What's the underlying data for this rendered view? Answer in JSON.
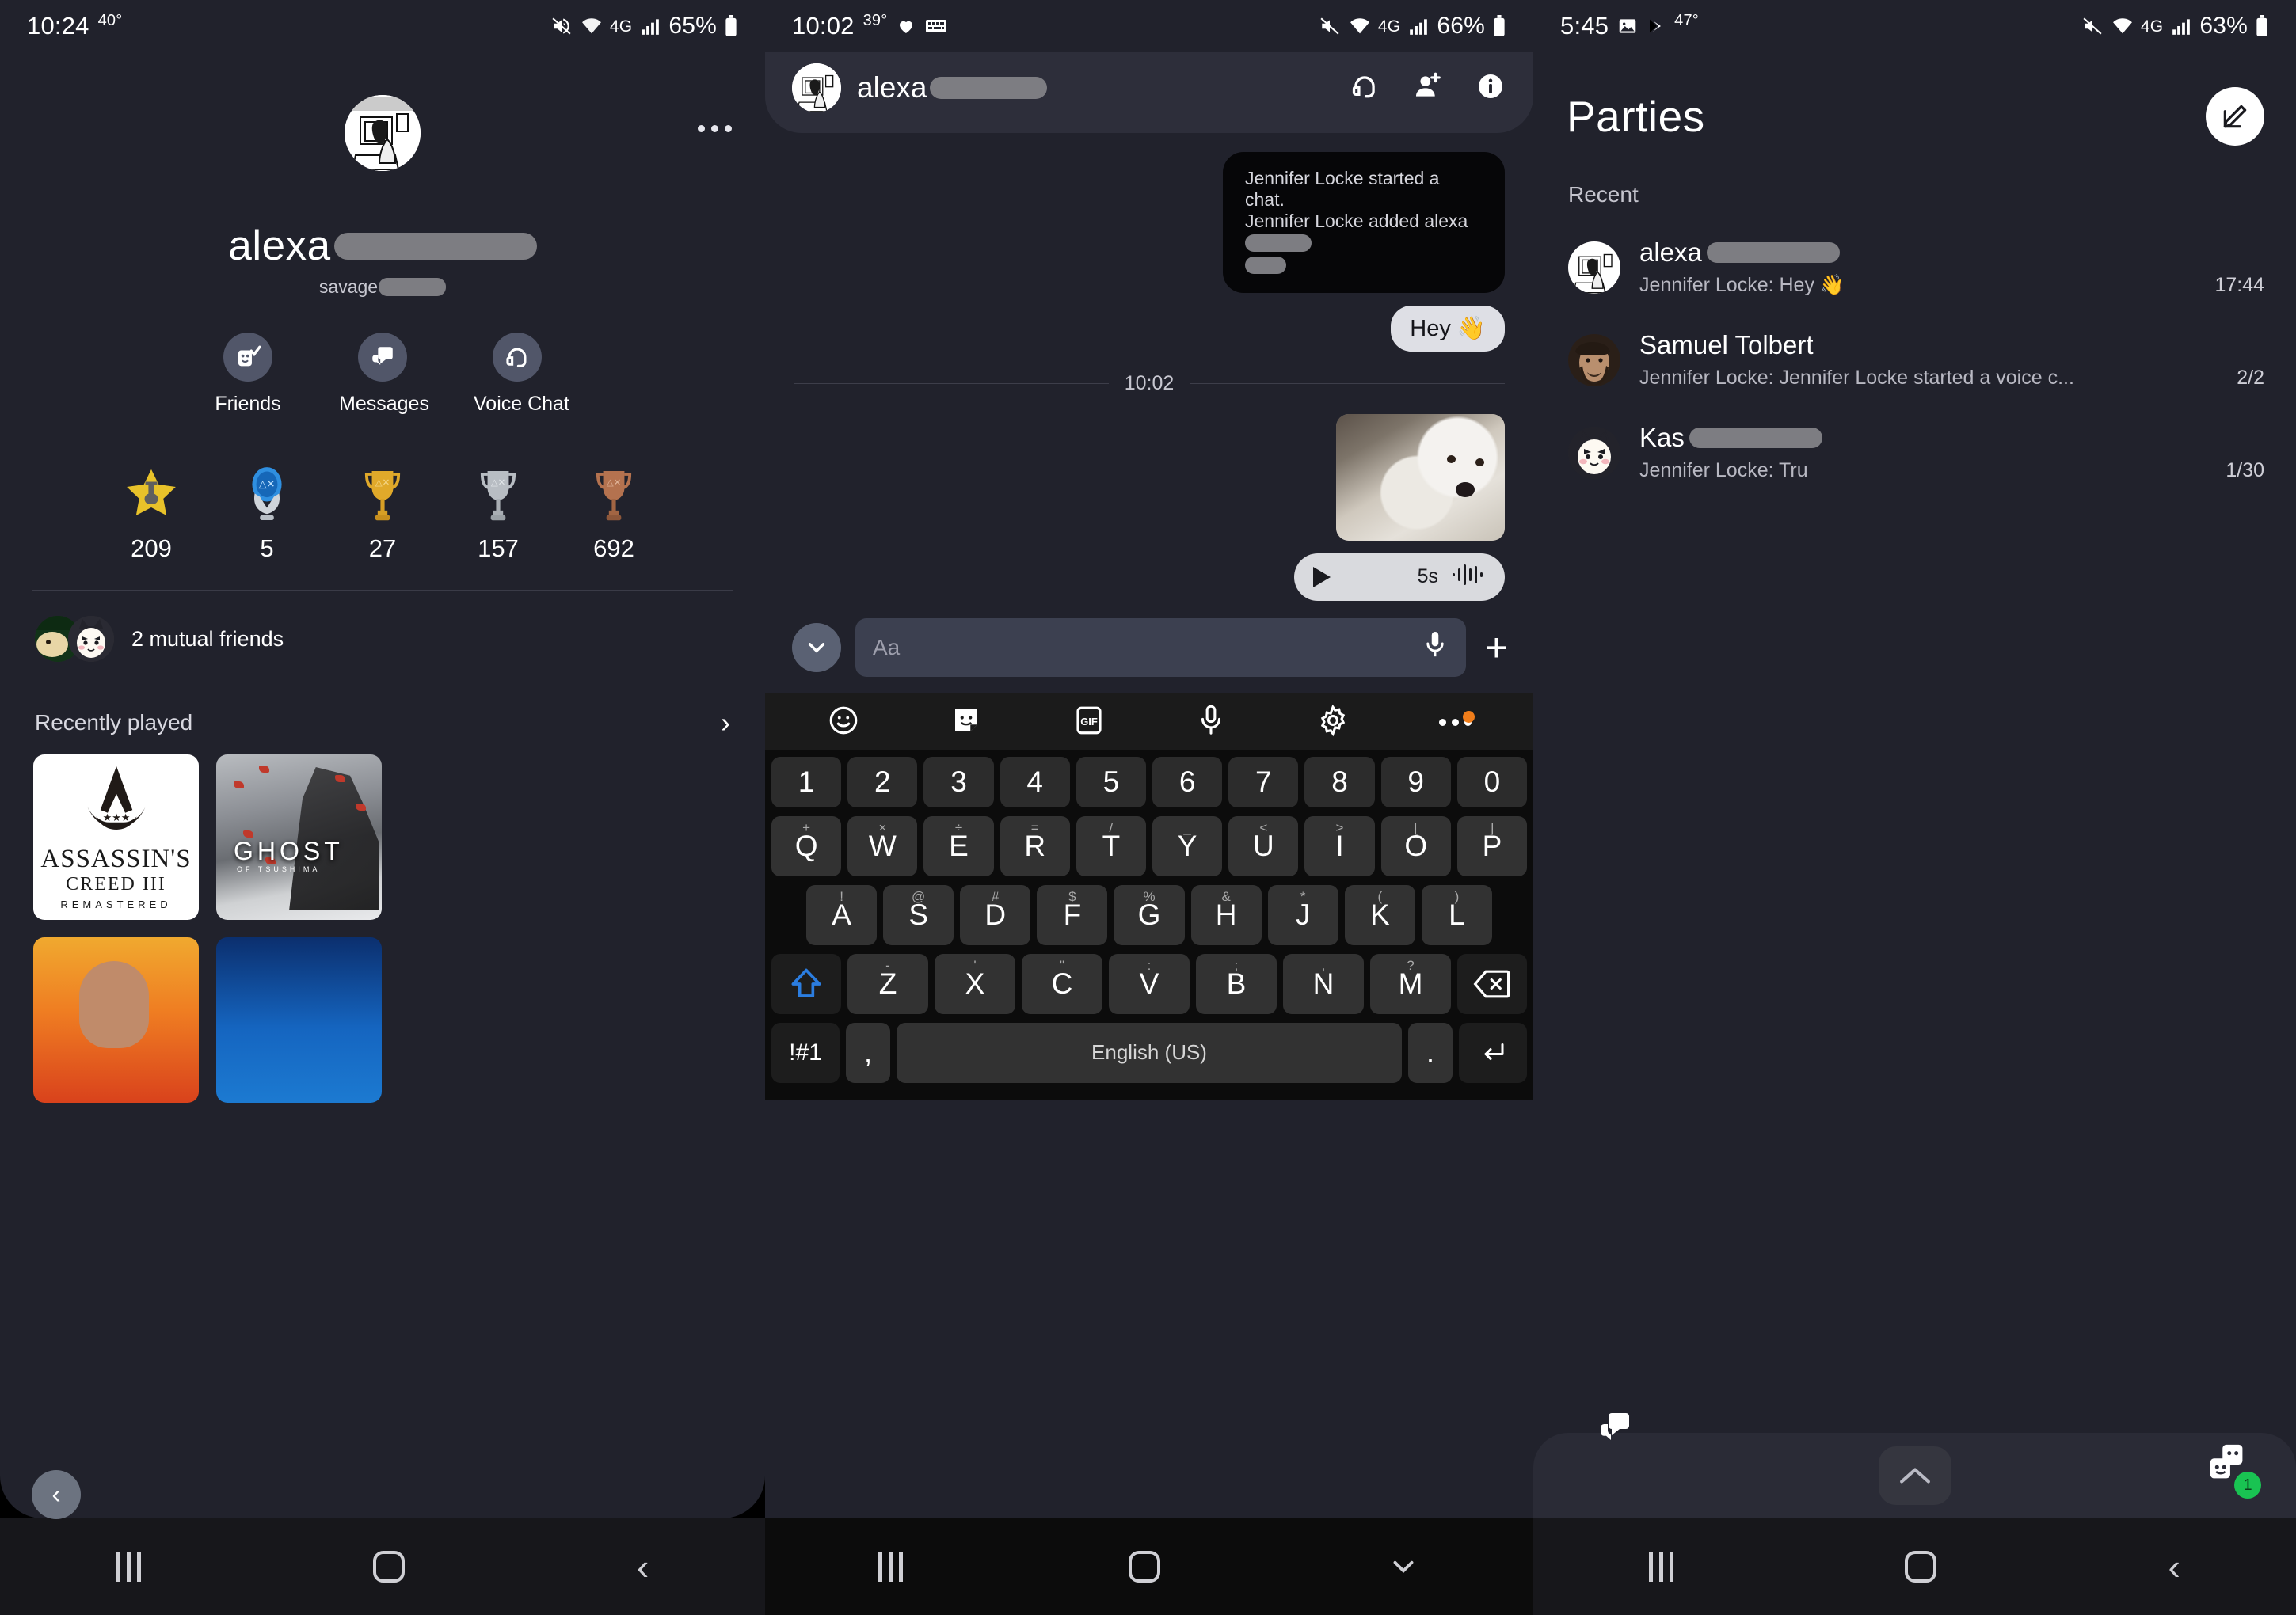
{
  "panel1": {
    "status": {
      "time": "10:24",
      "temp": "40°",
      "battery": "65%",
      "network": "4G",
      "icons": [
        "mute-icon",
        "wifi-icon",
        "signal-icon",
        "battery-icon"
      ]
    },
    "menu_icon": "overflow-menu-icon",
    "profile": {
      "name": "alexa",
      "name_redacted": true,
      "subname": "savage",
      "subname_redacted": true,
      "avatar": "user-avatar"
    },
    "actions": [
      {
        "label": "Friends",
        "icon": "friends-icon"
      },
      {
        "label": "Messages",
        "icon": "messages-icon"
      },
      {
        "label": "Voice Chat",
        "icon": "headset-icon"
      }
    ],
    "trophies": [
      {
        "icon": "trophy-level-star-icon",
        "count": "209"
      },
      {
        "icon": "trophy-platinum-icon",
        "count": "5"
      },
      {
        "icon": "trophy-gold-icon",
        "count": "27"
      },
      {
        "icon": "trophy-silver-icon",
        "count": "157"
      },
      {
        "icon": "trophy-bronze-icon",
        "count": "692"
      }
    ],
    "mutual_friends": "2 mutual friends",
    "recently_played": {
      "label": "Recently played",
      "chevron": "chevron-right-icon"
    },
    "games": [
      {
        "title": "ASSASSIN'S",
        "sub": "CREED III",
        "sub2": "REMASTERED",
        "art": "assassins-creed-3-remastered"
      },
      {
        "title": "GHOST",
        "sub": "OF TSUSHIMA",
        "art": "ghost-of-tsushima"
      },
      {
        "title": "",
        "art": "orange-western-game"
      },
      {
        "title": "",
        "art": "blue-space-game"
      }
    ],
    "carousel_back_icon": "chevron-left-icon",
    "navbar": [
      "recents-icon",
      "home-icon",
      "back-icon"
    ]
  },
  "panel2": {
    "status": {
      "time": "10:02",
      "temp": "39°",
      "battery": "66%",
      "network": "4G",
      "icons": [
        "heart-icon",
        "keyboard-icon",
        "mute-icon",
        "wifi-icon",
        "signal-icon",
        "battery-icon"
      ]
    },
    "header": {
      "name": "alexa",
      "name_redacted": true,
      "icons": [
        "headset-icon",
        "add-person-icon",
        "info-icon"
      ]
    },
    "messages": [
      {
        "type": "system",
        "line1": "Jennifer Locke started a chat.",
        "line2": "Jennifer Locke added alexa",
        "redacted": true
      },
      {
        "type": "outgoing",
        "text": "Hey 👋"
      },
      {
        "type": "timestamp",
        "text": "10:02"
      },
      {
        "type": "image",
        "alt": "photo-of-dog"
      },
      {
        "type": "audio",
        "duration": "5s",
        "play_icon": "play-icon",
        "waveform_icon": "waveform-icon"
      }
    ],
    "composer": {
      "expand_icon": "chevron-down-icon",
      "placeholder": "Aa",
      "value": "",
      "mic_icon": "microphone-icon",
      "plus_icon": "plus-icon"
    },
    "kb_toolbar": [
      "emoji-icon",
      "sticker-icon",
      "gif-icon",
      "voice-input-icon",
      "settings-icon",
      "more-icon"
    ],
    "keyboard": {
      "row_numbers": [
        "1",
        "2",
        "3",
        "4",
        "5",
        "6",
        "7",
        "8",
        "9",
        "0"
      ],
      "row1": [
        {
          "k": "Q",
          "s": "+"
        },
        {
          "k": "W",
          "s": "×"
        },
        {
          "k": "E",
          "s": "÷"
        },
        {
          "k": "R",
          "s": "="
        },
        {
          "k": "T",
          "s": "/"
        },
        {
          "k": "Y",
          "s": "_"
        },
        {
          "k": "U",
          "s": "<"
        },
        {
          "k": "I",
          "s": ">"
        },
        {
          "k": "O",
          "s": "["
        },
        {
          "k": "P",
          "s": "]"
        }
      ],
      "row2": [
        {
          "k": "A",
          "s": "!"
        },
        {
          "k": "S",
          "s": "@"
        },
        {
          "k": "D",
          "s": "#"
        },
        {
          "k": "F",
          "s": "$"
        },
        {
          "k": "G",
          "s": "%"
        },
        {
          "k": "H",
          "s": "&"
        },
        {
          "k": "J",
          "s": "*"
        },
        {
          "k": "K",
          "s": "("
        },
        {
          "k": "L",
          "s": ")"
        }
      ],
      "row3": [
        {
          "k": "Z",
          "s": "-"
        },
        {
          "k": "X",
          "s": "'"
        },
        {
          "k": "C",
          "s": "\""
        },
        {
          "k": "V",
          "s": ":"
        },
        {
          "k": "B",
          "s": ";"
        },
        {
          "k": "N",
          "s": ","
        },
        {
          "k": "M",
          "s": "?"
        }
      ],
      "shift_icon": "shift-icon",
      "backspace_icon": "backspace-icon",
      "symbols_label": "!#1",
      "comma": ",",
      "space_label": "English (US)",
      "period": ".",
      "enter_icon": "enter-icon"
    },
    "navbar": [
      "recents-icon",
      "home-icon",
      "hide-keyboard-icon"
    ]
  },
  "panel3": {
    "status": {
      "time": "5:45",
      "temp": "47°",
      "battery": "63%",
      "network": "4G",
      "icons": [
        "photo-icon",
        "play-store-icon",
        "mute-icon",
        "wifi-icon",
        "signal-icon",
        "battery-icon"
      ]
    },
    "title": "Parties",
    "compose_icon": "compose-icon",
    "section_label": "Recent",
    "items": [
      {
        "name": "alexa",
        "name_redacted": true,
        "snippet": "Jennifer Locke: Hey 👋",
        "meta": "17:44",
        "avatar": "user-avatar"
      },
      {
        "name": "Samuel Tolbert",
        "name_redacted": false,
        "snippet": "Jennifer Locke: Jennifer Locke started a voice c...",
        "meta": "2/2",
        "avatar": "man-avatar"
      },
      {
        "name": "Kas",
        "name_redacted": true,
        "snippet": "Jennifer Locke: Tru",
        "meta": "1/30",
        "avatar": "cat-avatar"
      }
    ],
    "bottom_bar": {
      "messages_icon": "messages-icon",
      "expand_icon": "chevron-up-icon",
      "parties_icon": "parties-icon",
      "badge": "1"
    },
    "navbar": [
      "recents-icon",
      "home-icon",
      "back-icon"
    ]
  },
  "colors": {
    "background": "#21222c",
    "header": "#2d2e3a",
    "keyboard": "#0c0c0c",
    "accent_green": "#19c352",
    "accent_orange": "#f07d1a",
    "redact": "#7d7d82"
  }
}
